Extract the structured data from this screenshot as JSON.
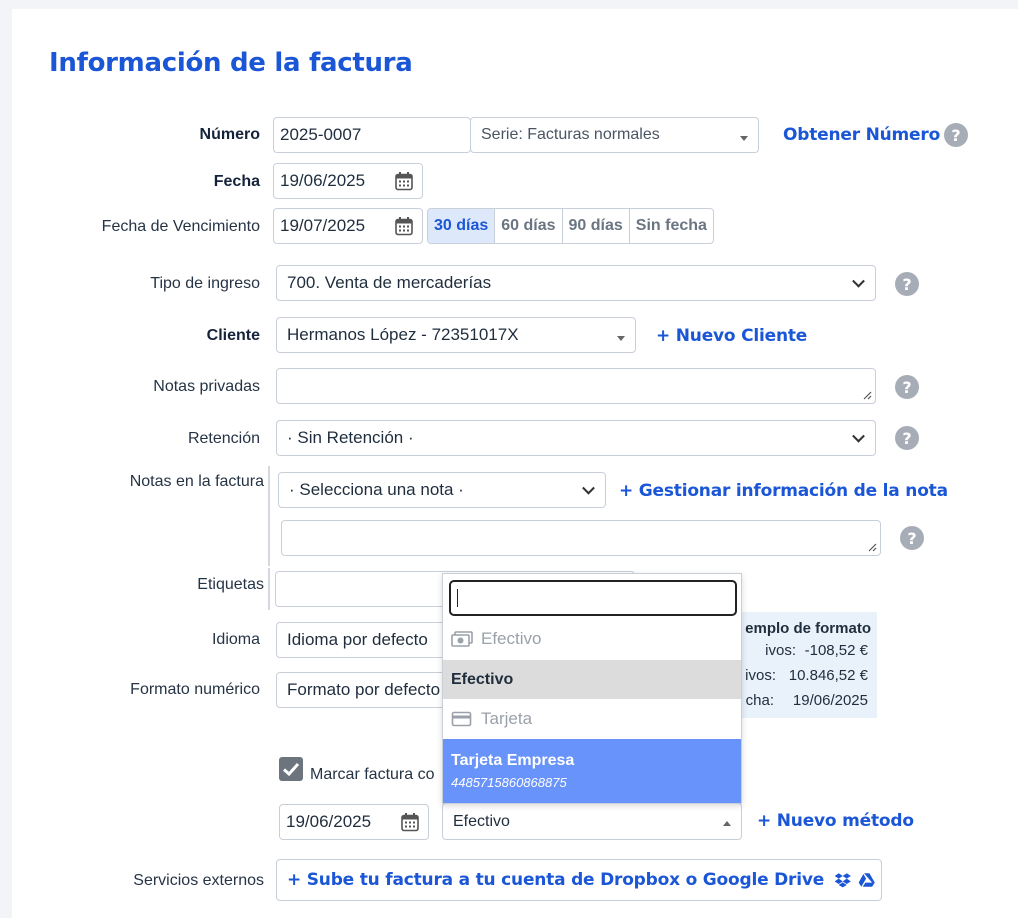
{
  "title": "Información de la factura",
  "numero": {
    "label": "Número",
    "value": "2025-0007",
    "serie": "Serie: Facturas normales",
    "obtener_link": "Obtener Número"
  },
  "fecha": {
    "label": "Fecha",
    "value": "19/06/2025"
  },
  "vencimiento": {
    "label": "Fecha de Vencimiento",
    "value": "19/07/2025",
    "options": [
      "30 días",
      "60 días",
      "90 días",
      "Sin fecha"
    ],
    "active": "30 días"
  },
  "tipo_ingreso": {
    "label": "Tipo de ingreso",
    "value": "700. Venta de mercaderías"
  },
  "cliente": {
    "label": "Cliente",
    "value": "Hermanos López - 72351017X",
    "nuevo_link": "+ Nuevo Cliente"
  },
  "notas_privadas": {
    "label": "Notas privadas",
    "value": ""
  },
  "retencion": {
    "label": "Retención",
    "value": "· Sin Retención ·"
  },
  "notas_factura": {
    "label": "Notas en la factura",
    "select_value": "· Selecciona una nota ·",
    "gestionar_link": "+ Gestionar información de la nota",
    "text": ""
  },
  "etiquetas": {
    "label": "Etiquetas",
    "value": ""
  },
  "idioma": {
    "label": "Idioma",
    "value": "Idioma por defecto"
  },
  "formato": {
    "label": "Formato numérico",
    "value": "Formato por defecto"
  },
  "ejemplo": {
    "title": "emplo de formato",
    "rows": [
      {
        "label": "ivos:",
        "value": "-108,52 €"
      },
      {
        "label": "ivos:",
        "value": "10.846,52 €"
      },
      {
        "label": "cha:",
        "value": "19/06/2025"
      }
    ]
  },
  "pago": {
    "checkbox_label": "Marcar factura co",
    "checked": true,
    "fecha": "19/06/2025",
    "metodo": "Efectivo",
    "nuevo_metodo_link": "+ Nuevo método"
  },
  "dropdown": {
    "search_value": "",
    "groups": [
      {
        "label": "Efectivo",
        "icon": "cash-icon",
        "options": [
          {
            "label": "Efectivo",
            "sub": "",
            "state": "selected"
          }
        ]
      },
      {
        "label": "Tarjeta",
        "icon": "credit-card-icon",
        "options": [
          {
            "label": "Tarjeta Empresa",
            "sub": "4485715860868875",
            "state": "highlighted"
          }
        ]
      }
    ]
  },
  "servicios": {
    "label": "Servicios externos",
    "button": "+ Sube tu factura a tu cuenta de Dropbox o Google Drive"
  },
  "colors": {
    "accent": "#1a56d6",
    "highlight": "#6893fb",
    "selected_bg": "#dcdcdc",
    "example_bg": "#e9f1fb"
  }
}
